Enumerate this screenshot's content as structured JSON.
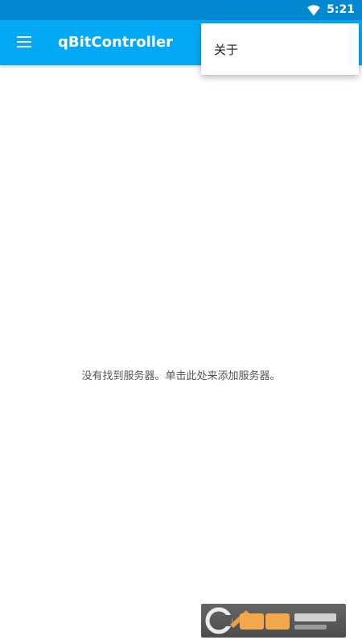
{
  "status_bar": {
    "time": "5:21",
    "wifi_icon": "wifi-icon",
    "background": "#0288d1"
  },
  "app_bar": {
    "title": "qBitController",
    "menu_icon": "hamburger-menu-icon",
    "background": "#03a9f4"
  },
  "overflow_menu": {
    "items": [
      {
        "label": "关于"
      }
    ]
  },
  "main": {
    "empty_message": "没有找到服务器。单击此处来添加服务器。"
  },
  "watermark": {
    "logo": "cr173-logo"
  }
}
